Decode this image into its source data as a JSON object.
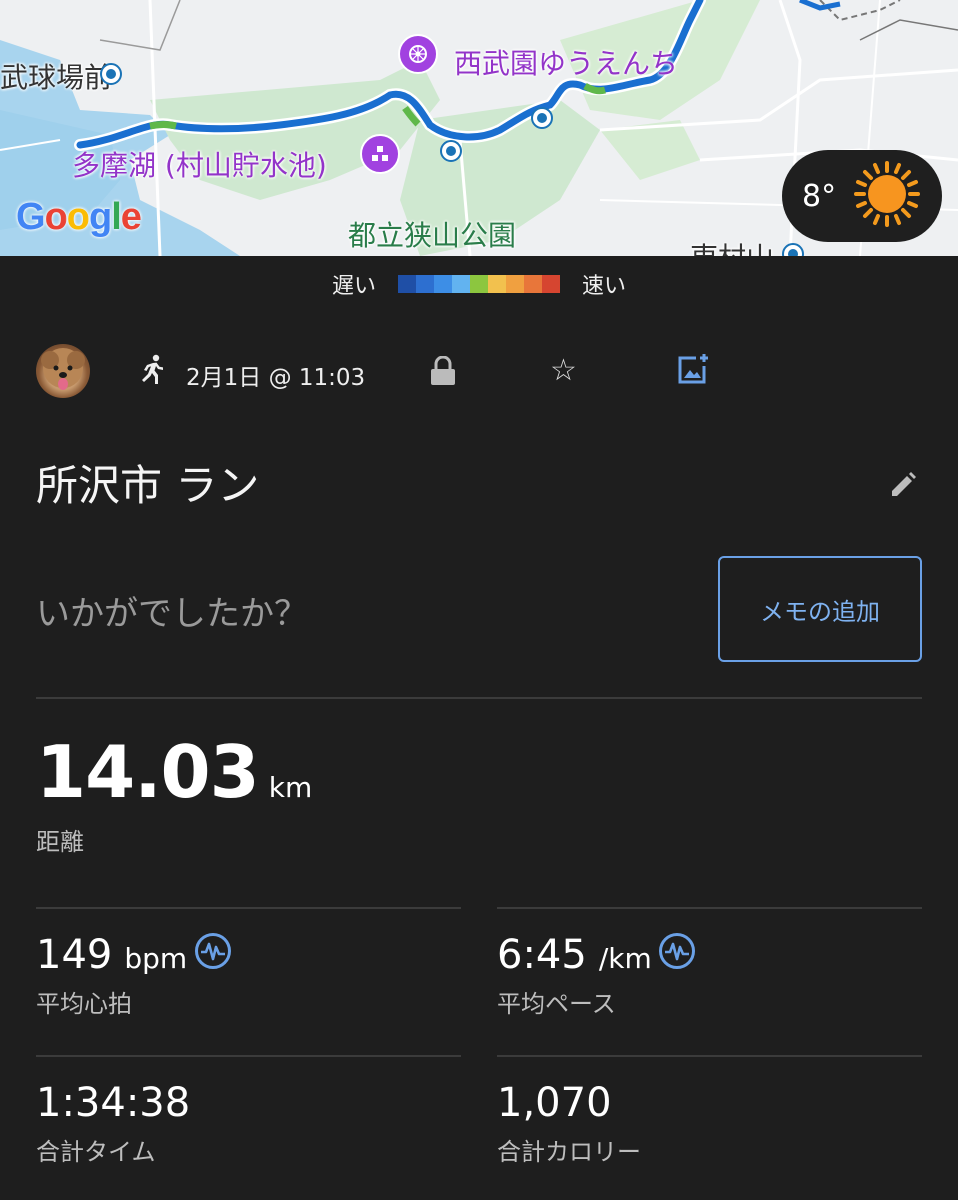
{
  "map": {
    "labels": {
      "stadium": "武球場前",
      "amusement_park": "西武園ゆうえんち",
      "lake": "多摩湖 (村山貯水池)",
      "park": "都立狭山公園",
      "town": "東村山"
    },
    "google_logo": "Google",
    "weather": {
      "temp": "8°",
      "icon": "sun-icon"
    }
  },
  "legend": {
    "slow": "遅い",
    "fast": "速い",
    "colors": [
      "#1f4fa6",
      "#2d6fd0",
      "#3d8ee6",
      "#62b3f0",
      "#8cc63f",
      "#f2c14e",
      "#f0a040",
      "#e8763a",
      "#d64530"
    ]
  },
  "activity": {
    "type_icon": "running-icon",
    "datetime": "2月1日 @ 11:03",
    "privacy_icon": "lock-icon",
    "favorite_icon": "star-icon",
    "add_photo_icon": "add-photo-icon",
    "title": "所沢市 ラン",
    "note_placeholder": "いかがでしたか？",
    "add_memo": "メモの追加"
  },
  "stats": {
    "distance": {
      "value": "14.03",
      "unit": "km",
      "label": "距離"
    },
    "heart_rate": {
      "value": "149",
      "unit": "bpm",
      "label": "平均心拍"
    },
    "pace": {
      "value": "6:45",
      "unit": "/km",
      "label": "平均ペース"
    },
    "time": {
      "value": "1:34:38",
      "label": "合計タイム"
    },
    "calories": {
      "value": "1,070",
      "label": "合計カロリー"
    }
  },
  "colors": {
    "accent": "#6aa0e6",
    "background": "#1e1e1e",
    "route": "#1a6fd0"
  }
}
